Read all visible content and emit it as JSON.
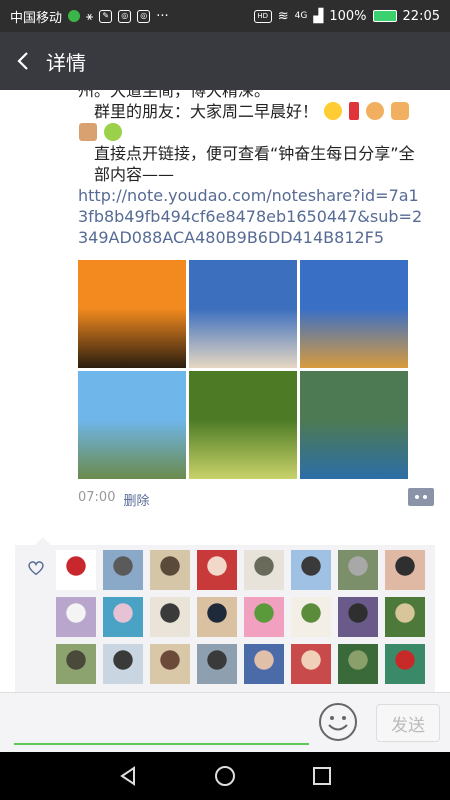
{
  "status": {
    "carrier": "中国移动",
    "battery": "100%",
    "time": "22:05",
    "signal": "4G"
  },
  "header": {
    "title": "详情"
  },
  "post": {
    "line0": "州。大道至简，博大精深。",
    "line1": "群里的朋友：大家周二早晨好！",
    "line2": "直接点开链接，便可查看“钟奋生每日分享”全部内容——",
    "link": "http://note.youdao.com/noteshare?id=7a13fb8b49fb494cf6e8478eb1650447&sub=2349AD088ACA480B9B6DD414B812F5",
    "time": "07:00",
    "delete": "删除"
  },
  "photos": [
    {
      "name": "photo-sunset-heron",
      "colors": [
        "#f28a1f",
        "#2a1d10"
      ]
    },
    {
      "name": "photo-snow-castle",
      "colors": [
        "#3d6fbf",
        "#e6d7c2"
      ]
    },
    {
      "name": "photo-harp-bridge",
      "colors": [
        "#3a6fc6",
        "#d89b3d"
      ]
    },
    {
      "name": "photo-palace-river",
      "colors": [
        "#6fb6ea",
        "#6b8a4b"
      ]
    },
    {
      "name": "photo-rice-terraces",
      "colors": [
        "#4d7b25",
        "#c9d26a"
      ]
    },
    {
      "name": "photo-lake-island",
      "colors": [
        "#4d7a53",
        "#2c6ea6"
      ]
    }
  ],
  "likes": {
    "avatars": [
      {
        "name": "avatar-seal",
        "colors": [
          "#fff",
          "#c8272d"
        ]
      },
      {
        "name": "avatar-statue",
        "colors": [
          "#8aa9c9",
          "#5a5a5a"
        ]
      },
      {
        "name": "avatar-man-hat",
        "colors": [
          "#d6c6a8",
          "#5a4a3a"
        ]
      },
      {
        "name": "avatar-man-red",
        "colors": [
          "#c83a3a",
          "#f1d8c8"
        ]
      },
      {
        "name": "avatar-painting",
        "colors": [
          "#e7e3da",
          "#6a6a5a"
        ]
      },
      {
        "name": "avatar-man-blue",
        "colors": [
          "#9fc2e4",
          "#3a3a3a"
        ]
      },
      {
        "name": "avatar-man-street",
        "colors": [
          "#7a8f6a",
          "#a8a8a8"
        ]
      },
      {
        "name": "avatar-woman-smile",
        "colors": [
          "#e0b9a5",
          "#2f2f2f"
        ]
      },
      {
        "name": "avatar-cat",
        "colors": [
          "#b8a6cc",
          "#f4f4f4"
        ]
      },
      {
        "name": "avatar-flowers",
        "colors": [
          "#4aa3c4",
          "#e6c2d4"
        ]
      },
      {
        "name": "avatar-calligraphy",
        "colors": [
          "#e9e3d8",
          "#3a3a3a"
        ]
      },
      {
        "name": "avatar-man-suit",
        "colors": [
          "#dac1a2",
          "#1e2a3a"
        ]
      },
      {
        "name": "avatar-woman-pink",
        "colors": [
          "#f1a0c0",
          "#5a9a3a"
        ]
      },
      {
        "name": "avatar-bamboo",
        "colors": [
          "#f3efe6",
          "#5b8c3b"
        ]
      },
      {
        "name": "avatar-man-dark",
        "colors": [
          "#6a5a8a",
          "#2f2f2f"
        ]
      },
      {
        "name": "avatar-landscape",
        "colors": [
          "#4d7a3a",
          "#d8c69a"
        ]
      },
      {
        "name": "avatar-man-outdoor",
        "colors": [
          "#8da36f",
          "#4a4a3a"
        ]
      },
      {
        "name": "avatar-man-glasses",
        "colors": [
          "#c9d6e2",
          "#3a3a3a"
        ]
      },
      {
        "name": "avatar-woman-walk",
        "colors": [
          "#d9c8a8",
          "#6b4a3a"
        ]
      },
      {
        "name": "avatar-man-city",
        "colors": [
          "#8e9fb0",
          "#3a3a3a"
        ]
      },
      {
        "name": "avatar-man-tie",
        "colors": [
          "#4a6aa8",
          "#e0c0a8"
        ]
      },
      {
        "name": "avatar-couple",
        "colors": [
          "#c84a4a",
          "#f0d0b8"
        ]
      },
      {
        "name": "avatar-street",
        "colors": [
          "#3a6a3a",
          "#8aa06a"
        ]
      },
      {
        "name": "avatar-woman-red",
        "colors": [
          "#3a8a6a",
          "#c82a2a"
        ]
      }
    ]
  },
  "input": {
    "send_label": "发送"
  }
}
